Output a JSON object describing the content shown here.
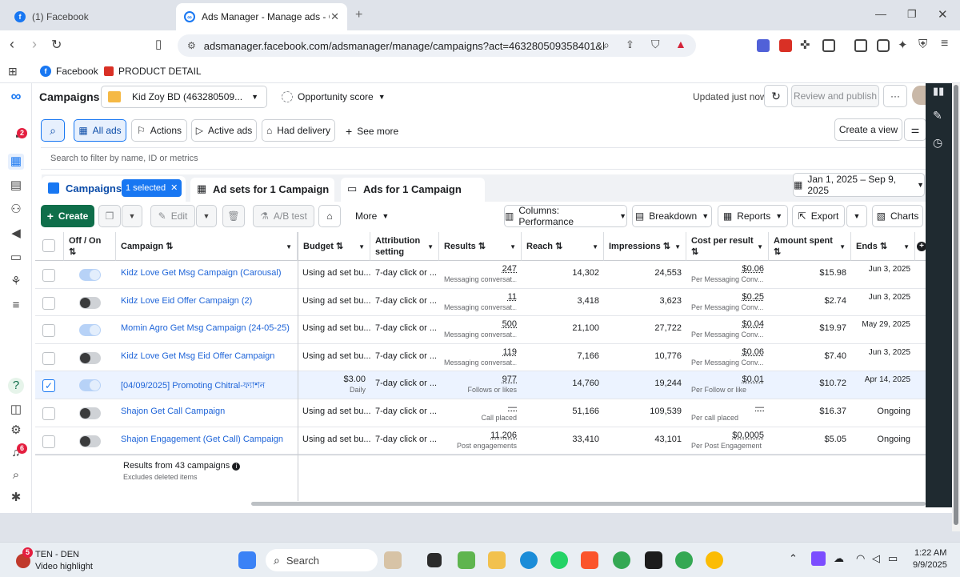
{
  "browser": {
    "tabs": [
      {
        "title": "(1) Facebook",
        "active": false
      },
      {
        "title": "Ads Manager - Manage ads - Ca",
        "active": true
      }
    ],
    "url": "adsmanager.facebook.com/adsmanager/manage/campaigns?act=463280509358401&b...",
    "bookmarks": [
      "Facebook",
      "PRODUCT DETAIL"
    ]
  },
  "app": {
    "title": "Campaigns",
    "account": "Kid Zoy BD (463280509...",
    "opportunity": "Opportunity score",
    "updated": "Updated just now",
    "review_publish": "Review and publish",
    "rail_badges": {
      "notifications": "2",
      "alerts": "6"
    }
  },
  "filters": {
    "all_ads": "All ads",
    "actions": "Actions",
    "active_ads": "Active ads",
    "had_delivery": "Had delivery",
    "see_more": "See more",
    "create_view": "Create a view",
    "search_placeholder": "Search to filter by name, ID or metrics"
  },
  "levels": {
    "campaigns": "Campaigns",
    "selected": "1 selected",
    "adsets": "Ad sets for 1 Campaign",
    "ads": "Ads for 1 Campaign",
    "date_range": "Jan 1, 2025 – Sep 9, 2025"
  },
  "actions_bar": {
    "create": "Create",
    "edit": "Edit",
    "ab_test": "A/B test",
    "more": "More",
    "columns": "Columns: Performance",
    "breakdown": "Breakdown",
    "reports": "Reports",
    "export": "Export",
    "charts": "Charts"
  },
  "table": {
    "headers": {
      "onoff": "Off / On",
      "campaign": "Campaign",
      "budget": "Budget",
      "attribution": "Attribution setting",
      "results": "Results",
      "reach": "Reach",
      "impressions": "Impressions",
      "cpr": "Cost per result",
      "spent": "Amount spent",
      "ends": "Ends"
    },
    "rows": [
      {
        "on": true,
        "checked": false,
        "name": "Kidz Love Get Msg Campaign (Carousal)",
        "budget": "Using ad set bu...",
        "budget_sub": "",
        "attribution": "7-day click or ...",
        "results": "247",
        "results_sub": "Messaging conversat...",
        "reach": "14,302",
        "impressions": "24,553",
        "cpr": "$0.06",
        "cpr_sub": "Per Messaging Conv...",
        "spent": "$15.98",
        "ends": "Jun 3, 2025"
      },
      {
        "on": false,
        "checked": false,
        "name": "Kidz Love Eid Offer Campaign (2)",
        "budget": "Using ad set bu...",
        "budget_sub": "",
        "attribution": "7-day click or ...",
        "results": "11",
        "results_sub": "Messaging conversat...",
        "reach": "3,418",
        "impressions": "3,623",
        "cpr": "$0.25",
        "cpr_sub": "Per Messaging Conv...",
        "spent": "$2.74",
        "ends": "Jun 3, 2025"
      },
      {
        "on": true,
        "checked": false,
        "name": "Momin Agro Get Msg Campaign (24-05-25)",
        "budget": "Using ad set bu...",
        "budget_sub": "",
        "attribution": "7-day click or ...",
        "results": "500",
        "results_sub": "Messaging conversat...",
        "reach": "21,100",
        "impressions": "27,722",
        "cpr": "$0.04",
        "cpr_sub": "Per Messaging Conv...",
        "spent": "$19.97",
        "ends": "May 29, 2025"
      },
      {
        "on": false,
        "checked": false,
        "name": "Kidz Love Get Msg Eid Offer Campaign",
        "budget": "Using ad set bu...",
        "budget_sub": "",
        "attribution": "7-day click or ...",
        "results": "119",
        "results_sub": "Messaging conversat...",
        "reach": "7,166",
        "impressions": "10,776",
        "cpr": "$0.06",
        "cpr_sub": "Per Messaging Conv...",
        "spent": "$7.40",
        "ends": "Jun 3, 2025"
      },
      {
        "on": true,
        "checked": true,
        "name": "[04/09/2025] Promoting Chitral-ফ্যাশন",
        "budget": "$3.00",
        "budget_sub": "Daily",
        "attribution": "7-day click or ...",
        "results": "977",
        "results_sub": "Follows or likes",
        "reach": "14,760",
        "impressions": "19,244",
        "cpr": "$0.01",
        "cpr_sub": "Per Follow or like",
        "spent": "$10.72",
        "ends": "Apr 14, 2025"
      },
      {
        "on": false,
        "checked": false,
        "name": "Shajon Get Call Campaign",
        "budget": "Using ad set bu...",
        "budget_sub": "",
        "attribution": "7-day click or ...",
        "results": "—",
        "results_sub": "Call placed",
        "reach": "51,166",
        "impressions": "109,539",
        "cpr": "—",
        "cpr_sub": "Per call placed",
        "spent": "$16.37",
        "ends": "Ongoing"
      },
      {
        "on": false,
        "checked": false,
        "name": "Shajon Engagement (Get Call) Campaign",
        "budget": "Using ad set bu...",
        "budget_sub": "",
        "attribution": "7-day click or ...",
        "results": "11,206",
        "results_sub": "Post engagements",
        "reach": "33,410",
        "impressions": "43,101",
        "cpr": "$0.0005",
        "cpr_sub": "Per Post Engagement",
        "spent": "$5.05",
        "ends": "Ongoing"
      }
    ],
    "footer_main": "Results from 43 campaigns",
    "footer_sub": "Excludes deleted items"
  },
  "taskbar": {
    "weather_badge": "5",
    "weather_title": "TEN - DEN",
    "weather_sub": "Video highlight",
    "search": "Search",
    "time": "1:22 AM",
    "date": "9/9/2025"
  },
  "colors": {
    "accent": "#1877f2",
    "create_green": "#0f6e4a",
    "badge_red": "#e41e3f",
    "right_rail": "#1f2a30"
  }
}
